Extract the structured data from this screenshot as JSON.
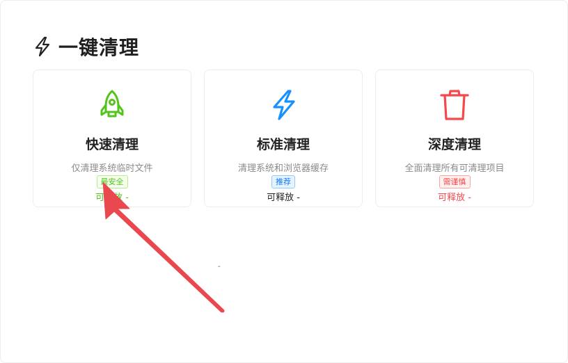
{
  "header": {
    "title": "一键清理",
    "icon": "lightning-icon"
  },
  "cards": [
    {
      "name": "快速清理",
      "description": "仅清理系统临时文件",
      "badge": "最安全",
      "release": "可释放 -",
      "icon": "rocket-icon",
      "accent": "#52c41a",
      "badge_bg": "#f6ffed",
      "badge_border": "#b7eb8f"
    },
    {
      "name": "标准清理",
      "description": "清理系统和浏览器缓存",
      "badge": "推荐",
      "release": "可释放 -",
      "icon": "lightning-icon",
      "accent": "#1890ff",
      "badge_bg": "#e6f4ff",
      "badge_border": "#91caff",
      "release_color": "#222222"
    },
    {
      "name": "深度清理",
      "description": "全面清理所有可清理项目",
      "badge": "需谨慎",
      "release": "可释放 -",
      "icon": "trash-icon",
      "accent": "#f5484a",
      "badge_bg": "#fff1f0",
      "badge_border": "#ffa39e"
    }
  ],
  "footer": {
    "dash": "-"
  },
  "annotation": {
    "arrow_color": "#e8484e"
  }
}
